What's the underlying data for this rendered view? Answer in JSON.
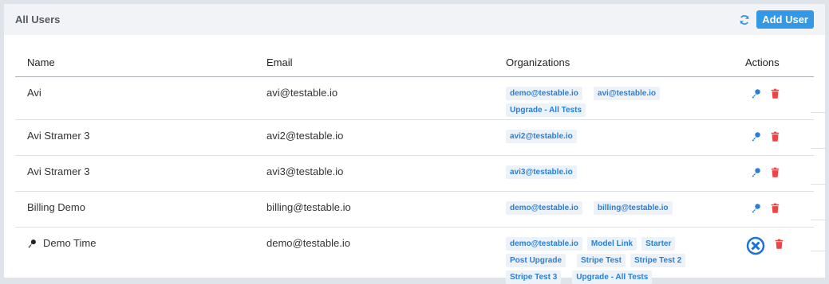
{
  "panel": {
    "title": "All Users",
    "add_user_label": "Add User",
    "accent_color": "#3399e6",
    "delete_color": "#ef4444"
  },
  "table": {
    "headers": {
      "name": "Name",
      "email": "Email",
      "organizations": "Organizations",
      "actions": "Actions"
    },
    "rows": [
      {
        "name": "Avi",
        "email": "avi@testable.io",
        "orgs": [
          "demo@testable.io",
          "avi@testable.io",
          "Upgrade - All Tests"
        ]
      },
      {
        "name": "Avi Stramer 3",
        "email": "avi2@testable.io",
        "orgs": [
          "avi2@testable.io"
        ]
      },
      {
        "name": "Avi Stramer 3",
        "email": "avi3@testable.io",
        "orgs": [
          "avi3@testable.io"
        ]
      },
      {
        "name": "Billing Demo",
        "email": "billing@testable.io",
        "orgs": [
          "demo@testable.io",
          "billing@testable.io"
        ]
      },
      {
        "name": "Demo Time",
        "email": "demo@testable.io",
        "orgs": [
          "demo@testable.io",
          "Model Link",
          "Starter",
          "Post Upgrade",
          "Stripe Test",
          "Stripe Test 2",
          "Stripe Test 3",
          "Upgrade - All Tests"
        ]
      }
    ]
  }
}
